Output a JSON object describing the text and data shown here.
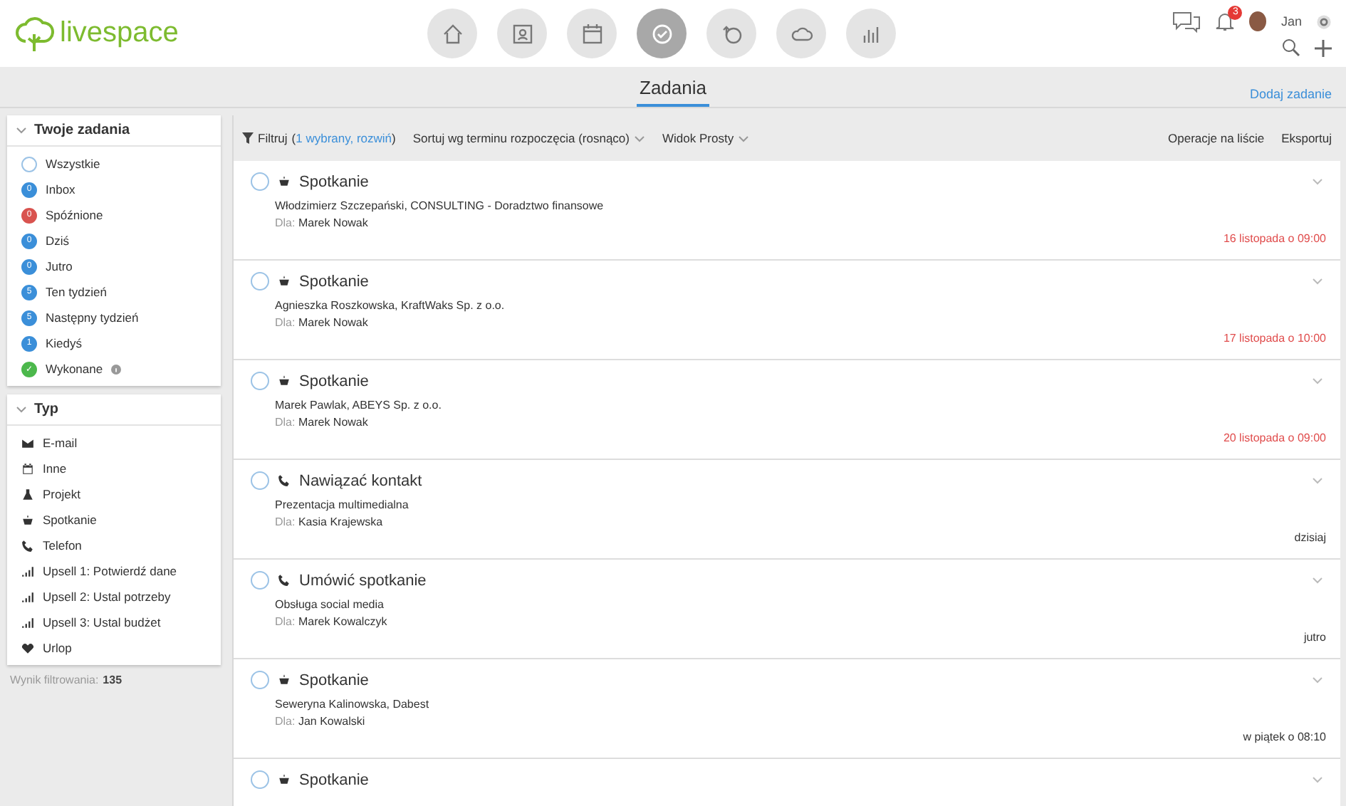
{
  "logo": {
    "text": "livespace"
  },
  "nav": [
    {
      "kind": "home",
      "selected": false
    },
    {
      "kind": "contacts",
      "selected": false
    },
    {
      "kind": "calendar",
      "selected": false
    },
    {
      "kind": "tasks",
      "selected": true
    },
    {
      "kind": "deals",
      "selected": false
    },
    {
      "kind": "cloud",
      "selected": false
    },
    {
      "kind": "reports",
      "selected": false
    }
  ],
  "user": {
    "notifications": "3",
    "name": "Jan"
  },
  "page": {
    "title": "Zadania",
    "add_link": "Dodaj zadanie"
  },
  "my_tasks": {
    "title": "Twoje zadania",
    "expanded": true,
    "items": [
      {
        "label": "Wszystkie",
        "color": "#ffffff",
        "info": false
      },
      {
        "label": "Inbox",
        "count": "0",
        "color": "#3b8fd9",
        "info": false
      },
      {
        "label": "Spóźnione",
        "count": "0",
        "color": "#d9534f",
        "info": false
      },
      {
        "label": "Dziś",
        "count": "0",
        "color": "#3b8fd9",
        "info": false
      },
      {
        "label": "Jutro",
        "count": "0",
        "color": "#3b8fd9",
        "info": false
      },
      {
        "label": "Ten tydzień",
        "count": "5",
        "color": "#3b8fd9",
        "info": false
      },
      {
        "label": "Następny tydzień",
        "count": "5",
        "color": "#3b8fd9",
        "info": false
      },
      {
        "label": "Kiedyś",
        "count": "1",
        "color": "#3b8fd9",
        "info": false
      },
      {
        "label": "Wykonane",
        "count": "✓",
        "color": "#4cb84c",
        "info": true
      }
    ]
  },
  "types": {
    "title": "Typ",
    "expanded": true,
    "items": [
      {
        "kind": "email",
        "label": "E-mail"
      },
      {
        "kind": "calendar",
        "label": "Inne"
      },
      {
        "kind": "project",
        "label": "Projekt"
      },
      {
        "kind": "meeting",
        "label": "Spotkanie"
      },
      {
        "kind": "phone",
        "label": "Telefon"
      },
      {
        "kind": "upsell",
        "label": "Upsell 1: Potwierdź dane"
      },
      {
        "kind": "upsell",
        "label": "Upsell 2: Ustal potrzeby"
      },
      {
        "kind": "upsell",
        "label": "Upsell 3: Ustal budżet"
      },
      {
        "kind": "heart",
        "label": "Urlop"
      }
    ]
  },
  "filter_result": {
    "label": "Wynik filtrowania:",
    "value": "135"
  },
  "toolbar": {
    "filter": "Filtruj",
    "filter_open": "(",
    "filter_link": "1 wybrany, rozwiń",
    "filter_close": ")",
    "sort": "Sortuj wg terminu rozpoczęcia (rosnąco)",
    "view": "Widok Prosty",
    "operations": "Operacje na liście",
    "export": "Eksportuj"
  },
  "tasks": [
    {
      "kind": "meeting",
      "title": "Spotkanie",
      "subject": "Włodzimierz Szczepański, CONSULTING - Doradztwo finansowe",
      "for_label": "Dla:",
      "for": "Marek Nowak",
      "due": "16 listopada o 09:00",
      "overdue": true,
      "done": false
    },
    {
      "kind": "meeting",
      "title": "Spotkanie",
      "subject": "Agnieszka Roszkowska, KraftWaks Sp. z o.o.",
      "for_label": "Dla:",
      "for": "Marek Nowak",
      "due": "17 listopada o 10:00",
      "overdue": true,
      "done": false
    },
    {
      "kind": "meeting",
      "title": "Spotkanie",
      "subject": "Marek Pawlak, ABEYS Sp. z o.o.",
      "for_label": "Dla:",
      "for": "Marek Nowak",
      "due": "20 listopada o 09:00",
      "overdue": true,
      "done": false
    },
    {
      "kind": "phone",
      "title": "Nawiązać kontakt",
      "subject": "Prezentacja multimedialna",
      "for_label": "Dla:",
      "for": "Kasia Krajewska",
      "due": "dzisiaj",
      "overdue": false,
      "done": false
    },
    {
      "kind": "phone",
      "title": "Umówić spotkanie",
      "subject": "Obsługa social media",
      "for_label": "Dla:",
      "for": "Marek Kowalczyk",
      "due": "jutro",
      "overdue": false,
      "done": false
    },
    {
      "kind": "meeting",
      "title": "Spotkanie",
      "subject": "Seweryna Kalinowska, Dabest",
      "for_label": "Dla:",
      "for": "Jan Kowalski",
      "due": "w piątek o 08:10",
      "overdue": false,
      "done": false
    },
    {
      "kind": "meeting",
      "title": "Spotkanie",
      "done": false
    }
  ]
}
